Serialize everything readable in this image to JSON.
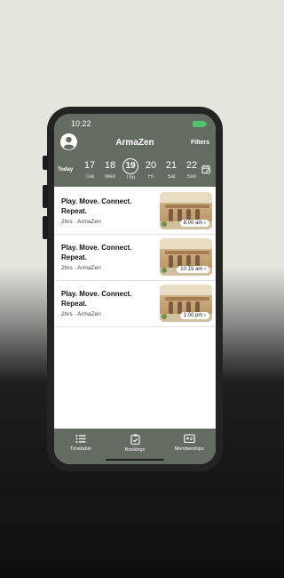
{
  "status_bar": {
    "time": "10:22"
  },
  "header": {
    "title": "ArmaZen",
    "filters_label": "Filters",
    "today_label": "Today"
  },
  "days": [
    {
      "num": "17",
      "weekday": "Tue",
      "active": false
    },
    {
      "num": "18",
      "weekday": "Wed",
      "active": false
    },
    {
      "num": "19",
      "weekday": "Thu",
      "active": true
    },
    {
      "num": "20",
      "weekday": "Fri",
      "active": false
    },
    {
      "num": "21",
      "weekday": "Sat",
      "active": false
    },
    {
      "num": "22",
      "weekday": "Sun",
      "active": false
    }
  ],
  "classes": [
    {
      "title": "Play. Move. Connect. Repeat.",
      "meta": "2hrs · ArmaZen",
      "time": "8:00 am"
    },
    {
      "title": "Play. Move. Connect. Repeat.",
      "meta": "2hrs · ArmaZen",
      "time": "10:15 am"
    },
    {
      "title": "Play. Move. Connect. Repeat.",
      "meta": "2hrs · ArmaZen",
      "time": "1:00 pm"
    }
  ],
  "tabs": [
    {
      "label": "Timetable",
      "icon": "list-icon"
    },
    {
      "label": "Bookings",
      "icon": "clipboard-icon"
    },
    {
      "label": "Memberships",
      "icon": "membership-card-icon"
    }
  ],
  "colors": {
    "brand": "#646b60",
    "background": "#ffffff"
  }
}
